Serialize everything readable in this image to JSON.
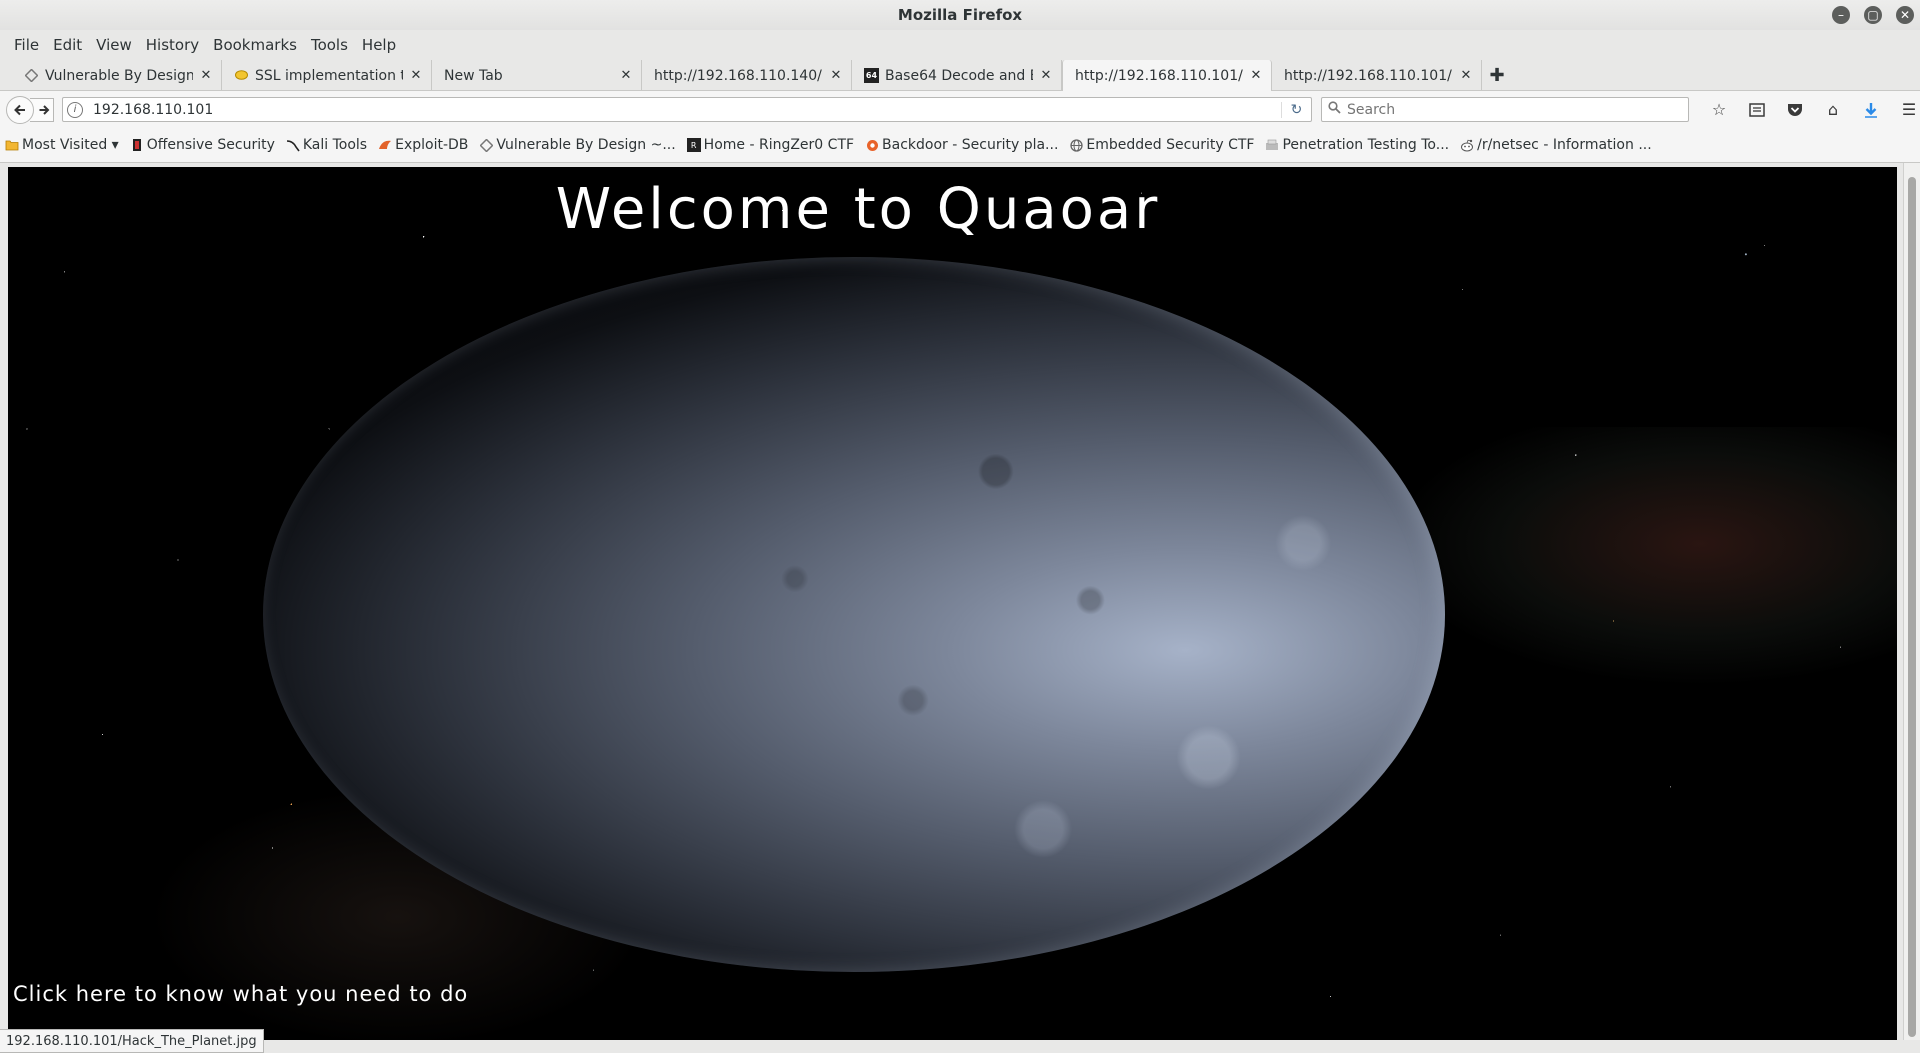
{
  "window": {
    "title": "Mozilla Firefox",
    "controls": [
      "minimize",
      "maximize",
      "close"
    ]
  },
  "menu": [
    "File",
    "Edit",
    "View",
    "History",
    "Bookmarks",
    "Tools",
    "Help"
  ],
  "tabs": [
    {
      "label": "Vulnerable By Design ...",
      "icon": "vulnhub-icon",
      "selected": false
    },
    {
      "label": "SSL implementation t...",
      "icon": "chat-bubble-icon",
      "selected": false
    },
    {
      "label": "New Tab",
      "icon": "",
      "selected": false
    },
    {
      "label": "http://192.168.110.140/",
      "icon": "",
      "selected": false
    },
    {
      "label": "Base64 Decode and E...",
      "icon": "base64-icon",
      "selected": false
    },
    {
      "label": "http://192.168.110.101/",
      "icon": "",
      "selected": true
    },
    {
      "label": "http://192.168.110.101/",
      "icon": "",
      "selected": false
    }
  ],
  "navbar": {
    "url": "192.168.110.101",
    "search_placeholder": "Search"
  },
  "bookmarks": [
    {
      "label": "Most Visited ▾",
      "icon": "folder-icon"
    },
    {
      "label": "Offensive Security",
      "icon": "offsec-icon"
    },
    {
      "label": "Kali Tools",
      "icon": "kali-icon"
    },
    {
      "label": "Exploit-DB",
      "icon": "exploitdb-icon"
    },
    {
      "label": "Vulnerable By Design ~...",
      "icon": "vulnhub-icon"
    },
    {
      "label": "Home - RingZer0 CTF",
      "icon": "ringzer0-icon"
    },
    {
      "label": "Backdoor - Security pla...",
      "icon": "backdoor-icon"
    },
    {
      "label": "Embedded Security CTF",
      "icon": "globe-icon"
    },
    {
      "label": "Penetration Testing To...",
      "icon": "pentest-icon"
    },
    {
      "label": "/r/netsec - Information ...",
      "icon": "reddit-icon"
    }
  ],
  "page": {
    "heading": "Welcome to Quaoar",
    "link_text": "Click here to know what you need to do"
  },
  "status": {
    "hover_url": "192.168.110.101/Hack_The_Planet.jpg"
  },
  "colors": {
    "chrome_bg": "#e8e8e7",
    "page_bg": "#000000",
    "download_accent": "#2a8ae8"
  }
}
